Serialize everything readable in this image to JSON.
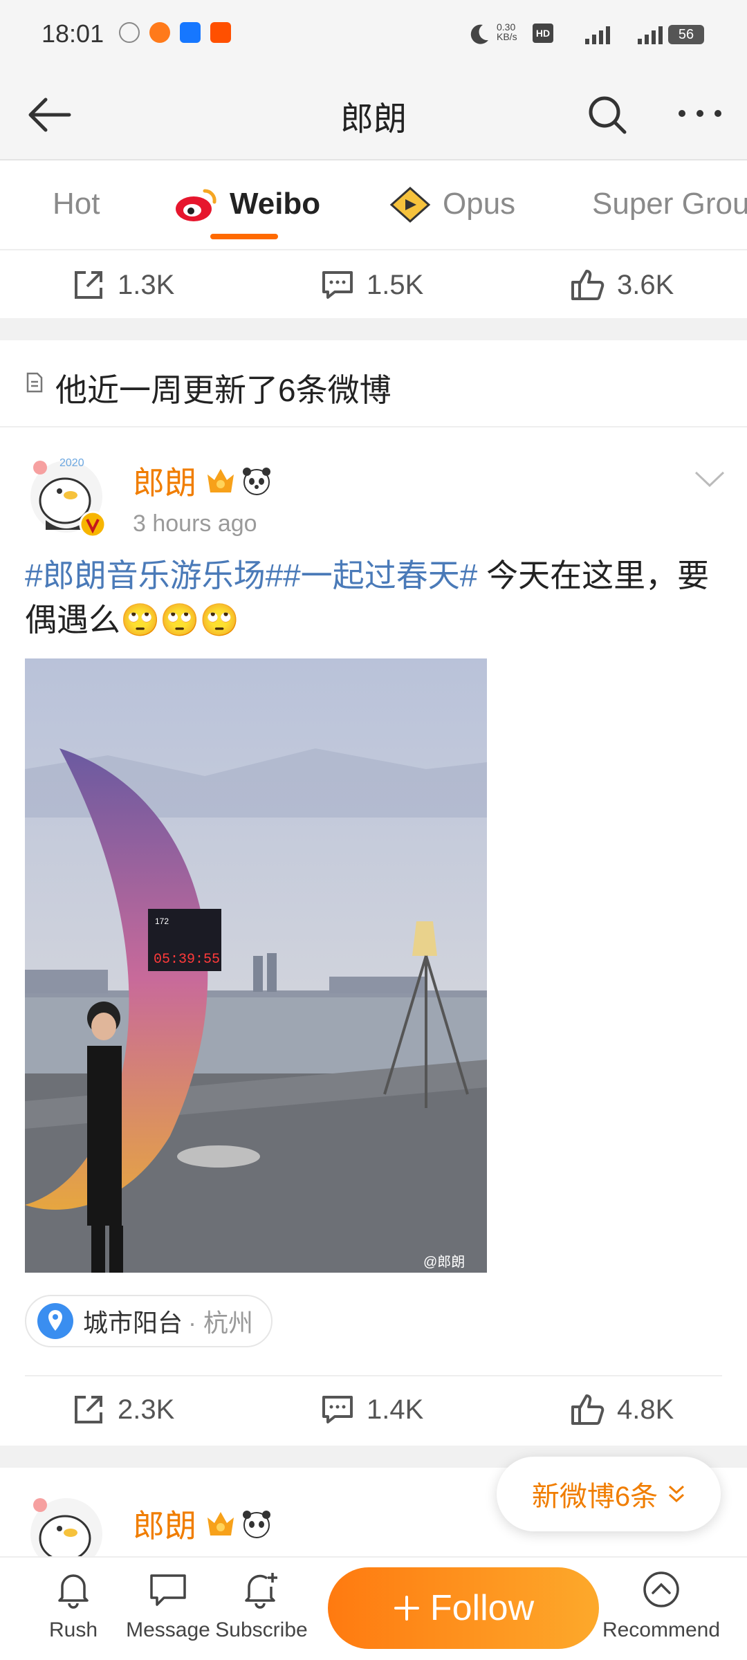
{
  "status_bar": {
    "time": "18:01",
    "net_speed": "0.30\nKB/s",
    "battery": "56"
  },
  "header": {
    "title": "郎朗"
  },
  "tabs": [
    {
      "label": "Hot"
    },
    {
      "label": "Weibo"
    },
    {
      "label": "Opus"
    },
    {
      "label": "Super Grou"
    }
  ],
  "top_stats": {
    "repost": "1.3K",
    "comment": "1.5K",
    "like": "3.6K"
  },
  "notice": {
    "text": "他近一周更新了6条微博"
  },
  "post1": {
    "author": "郎朗",
    "time": "3 hours ago",
    "text_tag1": "#郎朗音乐游乐场#",
    "text_tag2": "#一起过春天#",
    "text_rest": " 今天在这里，要偶遇么🙄🙄🙄",
    "photo_watermark": "@郎朗",
    "location": "城市阳台",
    "location_city": "· 杭州",
    "stats": {
      "repost": "2.3K",
      "comment": "1.4K",
      "like": "4.8K"
    }
  },
  "post2": {
    "author": "郎朗"
  },
  "new_posts_pill": "新微博6条",
  "bottom_nav": {
    "rush": "Rush",
    "message": "Message",
    "subscribe": "Subscribe",
    "follow": "Follow",
    "recommend": "Recommend"
  },
  "colors": {
    "accent": "#f07d00",
    "link": "#4a7ab8",
    "follow_start": "#ff7a10",
    "follow_end": "#fda92b"
  }
}
